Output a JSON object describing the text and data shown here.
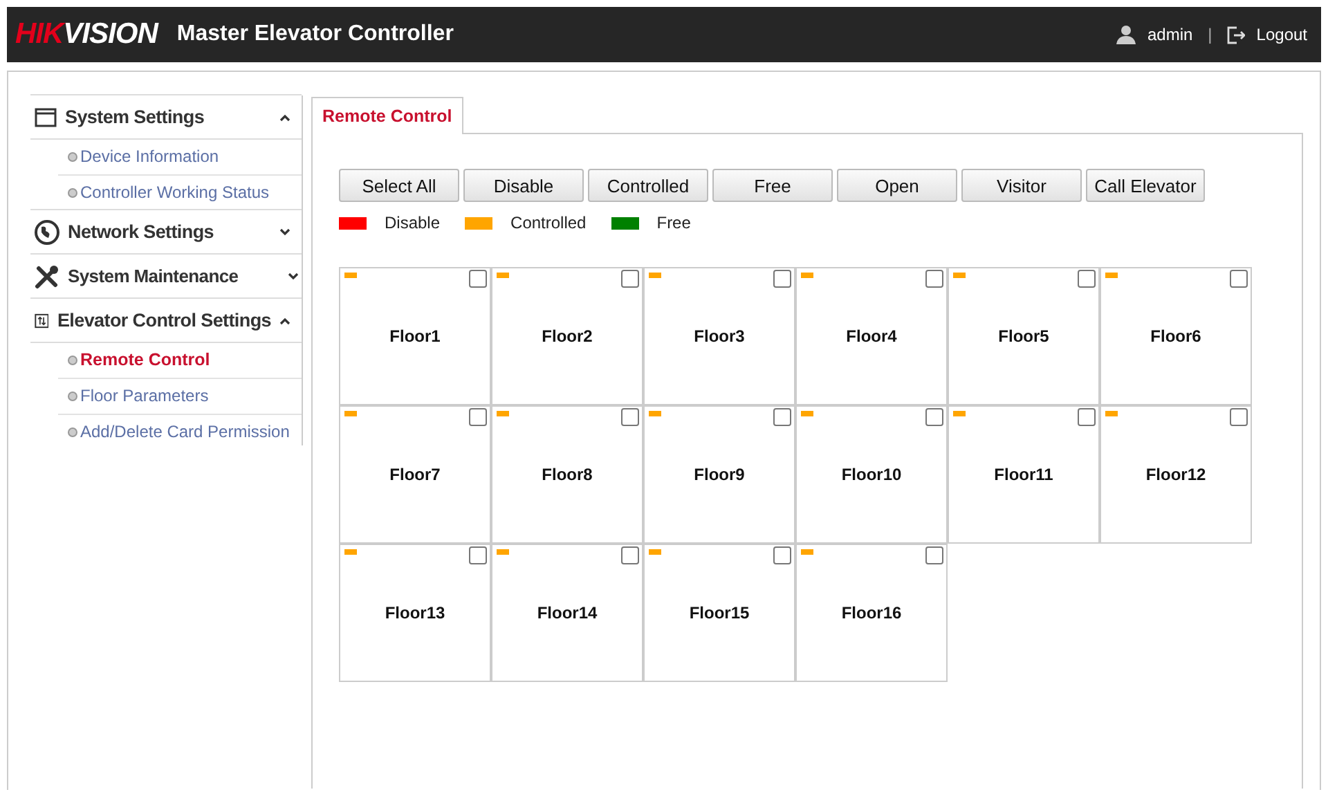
{
  "header": {
    "logo": {
      "accent": "HIK",
      "rest": "VISION"
    },
    "title": "Master Elevator Controller",
    "user": "admin",
    "separator": "|",
    "logout": "Logout"
  },
  "sidebar": [
    {
      "label": "System Settings",
      "kind": "window",
      "expanded": true,
      "children": [
        {
          "label": "Device Information",
          "selected": false
        },
        {
          "label": "Controller Working Status",
          "selected": false
        }
      ]
    },
    {
      "label": "Network Settings",
      "kind": "globe",
      "expanded": false
    },
    {
      "label": "System Maintenance",
      "kind": "tools",
      "expanded": false
    },
    {
      "label": "Elevator Control Settings",
      "kind": "elevator",
      "expanded": true,
      "children": [
        {
          "label": "Remote Control",
          "selected": true
        },
        {
          "label": "Floor Parameters",
          "selected": false
        },
        {
          "label": "Add/Delete Card Permission",
          "selected": false
        }
      ]
    }
  ],
  "tabs": [
    {
      "label": "Remote Control",
      "selected": true
    }
  ],
  "buttons": [
    "Select All",
    "Disable",
    "Controlled",
    "Free",
    "Open",
    "Visitor",
    "Call Elevator"
  ],
  "legend": [
    {
      "label": "Disable",
      "color": "#ff0000"
    },
    {
      "label": "Controlled",
      "color": "#ffa500"
    },
    {
      "label": "Free",
      "color": "#008000"
    }
  ],
  "floors": [
    {
      "label": "Floor1",
      "color": "#ffa500",
      "checked": false
    },
    {
      "label": "Floor2",
      "color": "#ffa500",
      "checked": false
    },
    {
      "label": "Floor3",
      "color": "#ffa500",
      "checked": false
    },
    {
      "label": "Floor4",
      "color": "#ffa500",
      "checked": false
    },
    {
      "label": "Floor5",
      "color": "#ffa500",
      "checked": false
    },
    {
      "label": "Floor6",
      "color": "#ffa500",
      "checked": false
    },
    {
      "label": "Floor7",
      "color": "#ffa500",
      "checked": false
    },
    {
      "label": "Floor8",
      "color": "#ffa500",
      "checked": false
    },
    {
      "label": "Floor9",
      "color": "#ffa500",
      "checked": false
    },
    {
      "label": "Floor10",
      "color": "#ffa500",
      "checked": false
    },
    {
      "label": "Floor11",
      "color": "#ffa500",
      "checked": false
    },
    {
      "label": "Floor12",
      "color": "#ffa500",
      "checked": false
    },
    {
      "label": "Floor13",
      "color": "#ffa500",
      "checked": false
    },
    {
      "label": "Floor14",
      "color": "#ffa500",
      "checked": false
    },
    {
      "label": "Floor15",
      "color": "#ffa500",
      "checked": false
    },
    {
      "label": "Floor16",
      "color": "#ffa500",
      "checked": false
    }
  ]
}
